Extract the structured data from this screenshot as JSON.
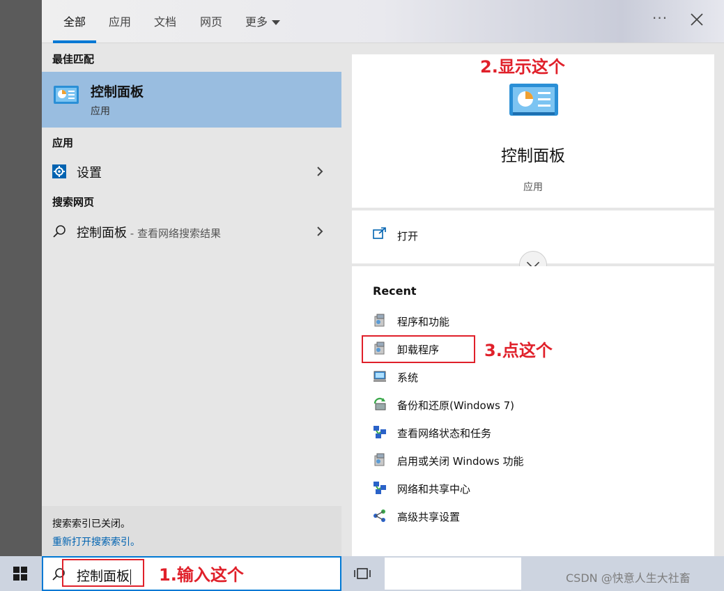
{
  "tabs": [
    "全部",
    "应用",
    "文档",
    "网页",
    "更多"
  ],
  "left": {
    "best_match_heading": "最佳匹配",
    "best_match": {
      "title": "控制面板",
      "subtitle": "应用"
    },
    "apps_heading": "应用",
    "apps": [
      {
        "label": "设置"
      }
    ],
    "web_heading": "搜索网页",
    "web": [
      {
        "label": "控制面板",
        "hint": " - 查看网络搜索结果"
      }
    ],
    "index_note": {
      "line1": "搜索索引已关闭。",
      "line2": "重新打开搜索索引。"
    }
  },
  "right": {
    "app_title": "控制面板",
    "app_subtitle": "应用",
    "open_label": "打开",
    "recent_heading": "Recent",
    "recent": [
      {
        "label": "程序和功能",
        "icon": "programs-icon"
      },
      {
        "label": "卸载程序",
        "icon": "programs-icon"
      },
      {
        "label": "系统",
        "icon": "system-icon"
      },
      {
        "label": "备份和还原(Windows 7)",
        "icon": "backup-icon"
      },
      {
        "label": "查看网络状态和任务",
        "icon": "network-icon"
      },
      {
        "label": "启用或关闭 Windows 功能",
        "icon": "programs-icon"
      },
      {
        "label": "网络和共享中心",
        "icon": "network-icon"
      },
      {
        "label": "高级共享设置",
        "icon": "share-icon"
      }
    ]
  },
  "taskbar": {
    "search_value": "控制面板",
    "watermark": "CSDN @快意人生大社畜"
  },
  "annotations": {
    "step1": "1.输入这个",
    "step2": "2.显示这个",
    "step3": "3.点这个"
  },
  "colors": {
    "accent": "#0078d4",
    "highlight": "#99bde0",
    "annotation": "#e0202a"
  }
}
